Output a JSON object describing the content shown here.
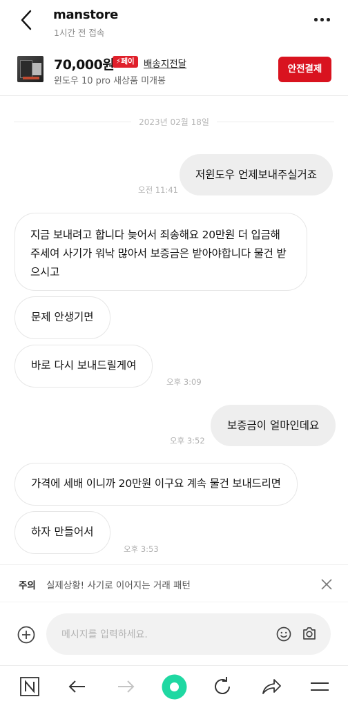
{
  "header": {
    "title": "manstore",
    "subtitle": "1시간 전 접속"
  },
  "product": {
    "price": "70,000원",
    "pay_badge": "⚡페이",
    "shipping": "배송지전달",
    "name": "윈도우 10 pro 새상품 미개봉",
    "safe_pay_label": "안전결제"
  },
  "chat": {
    "date": "2023년 02월 18일",
    "messages": [
      {
        "text": "저윈도우 언제보내주실거죠",
        "time": "오전 11:41"
      },
      {
        "text": "지금 보내려고 합니다 늦어서 죄송해요 20만원 더 입금해 주세여 사기가 워낙 많아서 보증금은 받아야합니다 물건 받으시고",
        "line1": "지금 보내려고 합니다 늦어서 죄송해요 20만원 더 입금해",
        "line2": "주세여 사기가 워낙 많아서 보증금은 받아야합니다 물건 받",
        "line3": "으시고"
      },
      {
        "text": "문제 안생기면"
      },
      {
        "text": "바로 다시 보내드릴게여",
        "time": "오후 3:09"
      },
      {
        "text": "보증금이 얼마인데요",
        "time": "오후 3:52"
      },
      {
        "text": "가격에 세배 이니까 20만원 이구요 계속 물건 보내드리면"
      },
      {
        "text": "하자 만들어서",
        "time": "오후 3:53"
      }
    ]
  },
  "warning": {
    "label": "주의",
    "text": "실제상황! 사기로 이어지는 거래 패턴"
  },
  "input": {
    "placeholder": "메시지를 입력하세요."
  },
  "colors": {
    "accent": "#d9131f",
    "my_bubble": "#eeeeee",
    "browser_green": "#1fd8a2"
  },
  "icons": [
    "back-arrow-icon",
    "more-dots-icon",
    "close-icon",
    "plus-circle-icon",
    "emoji-icon",
    "camera-icon",
    "naver-n-icon",
    "browser-back-icon",
    "browser-forward-icon",
    "green-dot-icon",
    "refresh-icon",
    "share-icon",
    "menu-icon"
  ]
}
